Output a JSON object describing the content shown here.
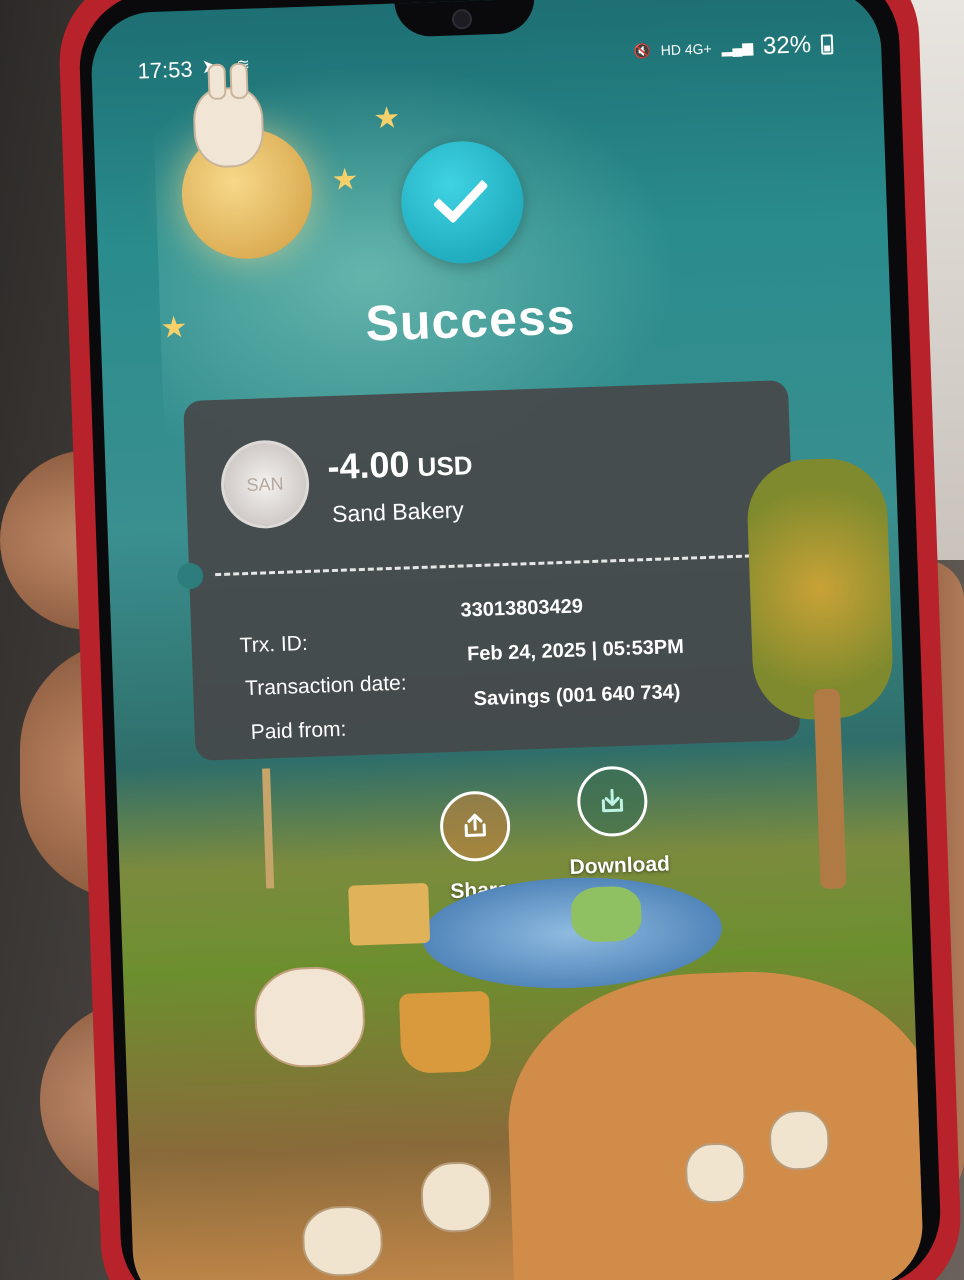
{
  "status_bar": {
    "time": "17:53",
    "network": "HD 4G+",
    "battery": "32%"
  },
  "result": {
    "title": "Success"
  },
  "receipt": {
    "amount": "-4.00",
    "currency": "USD",
    "merchant": "Sand Bakery",
    "logo_text": "SAN",
    "fields": [
      {
        "label": "Trx. ID:",
        "value": "33013803429"
      },
      {
        "label": "Transaction date:",
        "value": "Feb 24, 2025 | 05:53PM"
      },
      {
        "label": "Paid from:",
        "value": "Savings (001 640 734)"
      }
    ]
  },
  "actions": {
    "share_label": "Share",
    "download_label": "Download"
  },
  "icons": {
    "success": "check-icon",
    "share": "share-icon",
    "download": "download-icon"
  }
}
